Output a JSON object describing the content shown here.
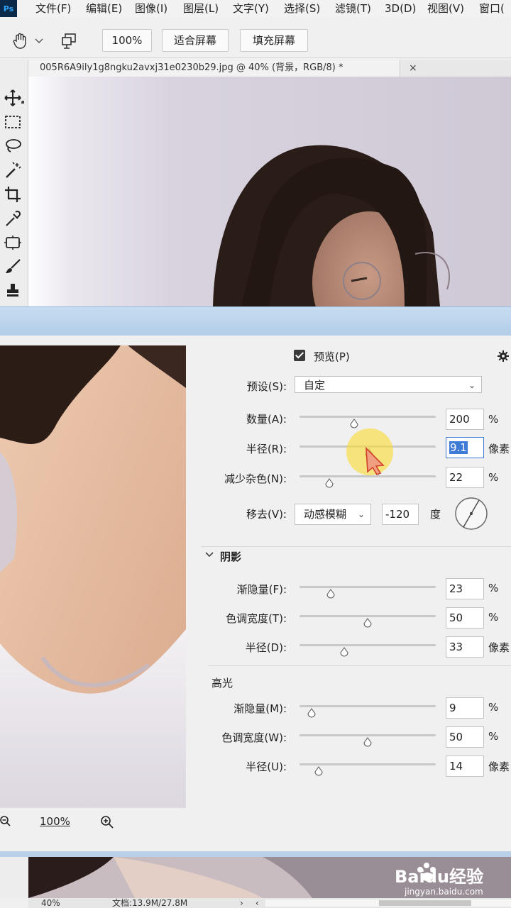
{
  "app": {
    "logo": "Ps"
  },
  "menu": [
    "文件(F)",
    "编辑(E)",
    "图像(I)",
    "图层(L)",
    "文字(Y)",
    "选择(S)",
    "滤镜(T)",
    "3D(D)",
    "视图(V)",
    "窗口("
  ],
  "options": {
    "zoom_value": "100%",
    "fit_screen": "适合屏幕",
    "fill_screen": "填充屏幕"
  },
  "document": {
    "tab_title": "005R6A9ily1g8ngku2avxj31e0230b29.jpg @ 40% (背景，RGB/8) *",
    "close": "×"
  },
  "tools": [
    "move-tool",
    "marquee-tool",
    "lasso-tool",
    "magic-wand-tool",
    "crop-tool",
    "eyedropper-tool",
    "patch-tool",
    "brush-tool",
    "stamp-tool"
  ],
  "dialog": {
    "preview_label": "预览(P)",
    "preview_checked": true,
    "preset_label": "预设(S):",
    "preset_value": "自定",
    "preview_zoom": "100%",
    "sharpen": [
      {
        "label": "数量(A):",
        "value": "200",
        "unit": "%",
        "level": 0.4
      },
      {
        "label": "半径(R):",
        "value": "9.1",
        "unit": "像素",
        "level": 0.51
      },
      {
        "label": "减少杂色(N):",
        "value": "22",
        "unit": "%",
        "level": 0.22
      }
    ],
    "remove": {
      "label": "移去(V):",
      "value": "动感模糊",
      "angle": "-120",
      "angle_unit": "度"
    },
    "shadows": {
      "title": "阴影",
      "rows": [
        {
          "label": "渐隐量(F):",
          "value": "23",
          "unit": "%",
          "level": 0.23
        },
        {
          "label": "色调宽度(T):",
          "value": "50",
          "unit": "%",
          "level": 0.5
        },
        {
          "label": "半径(D):",
          "value": "33",
          "unit": "像素",
          "level": 0.33
        }
      ]
    },
    "highlights": {
      "title": "高光",
      "rows": [
        {
          "label": "渐隐量(M):",
          "value": "9",
          "unit": "%",
          "level": 0.09
        },
        {
          "label": "色调宽度(W):",
          "value": "50",
          "unit": "%",
          "level": 0.5
        },
        {
          "label": "半径(U):",
          "value": "14",
          "unit": "像素",
          "level": 0.14
        }
      ]
    }
  },
  "status": {
    "zoom": "40%",
    "doc_info": "文档:13.9M/27.8M",
    "arrow": "›",
    "left_arrow": "‹"
  },
  "watermark": {
    "brand": "Baidu经验",
    "url": "jingyan.baidu.com"
  }
}
